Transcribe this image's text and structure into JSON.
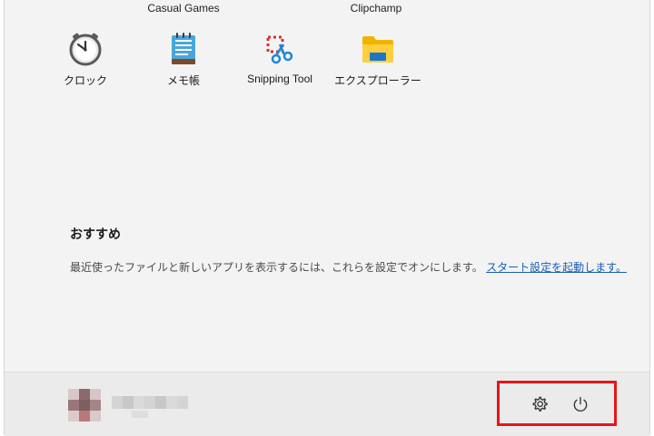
{
  "pinned": {
    "top_labels": [
      {
        "name": "casual-games-label",
        "text": "Casual Games"
      },
      {
        "name": "clipchamp-label",
        "text": "Clipchamp"
      }
    ],
    "apps": [
      {
        "name": "app-clock",
        "icon": "clock-icon",
        "label": "クロック"
      },
      {
        "name": "app-notepad",
        "icon": "notepad-icon",
        "label": "メモ帳"
      },
      {
        "name": "app-snipping-tool",
        "icon": "snipping-tool-icon",
        "label": "Snipping Tool"
      },
      {
        "name": "app-explorer",
        "icon": "folder-icon",
        "label": "エクスプローラー"
      }
    ]
  },
  "recommended": {
    "title": "おすすめ",
    "message": "最近使ったファイルと新しいアプリを表示するには、これらを設定でオンにします。",
    "link": "スタート設定を起動します。"
  },
  "footer": {
    "user_name": "",
    "settings_icon": "gear-icon",
    "power_icon": "power-icon",
    "highlight_color": "#e8141b"
  },
  "colors": {
    "menu_background": "#f3f3f3",
    "footer_background": "#ebebeb",
    "link": "#1a5fb4"
  }
}
